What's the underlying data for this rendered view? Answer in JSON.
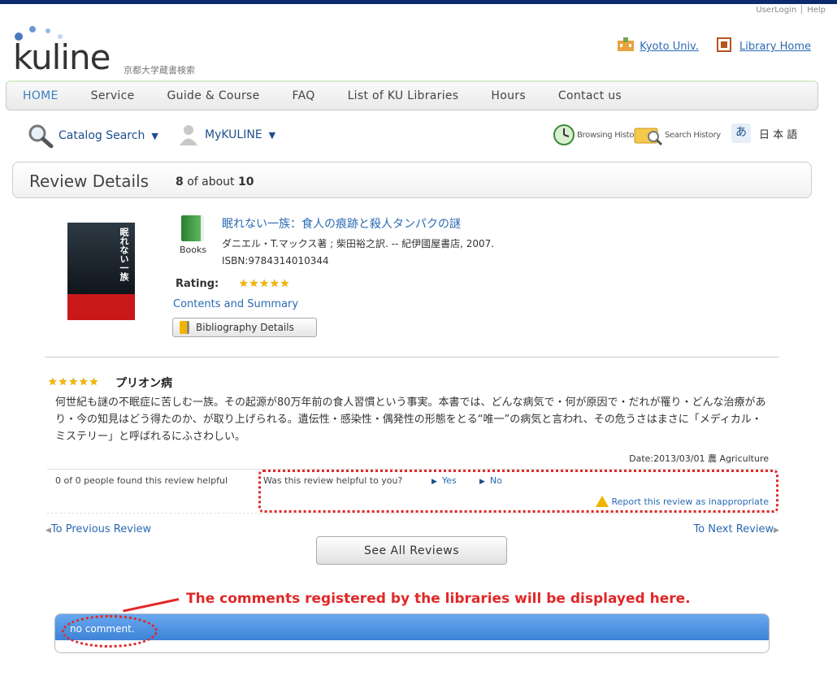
{
  "header": {
    "user_login": "UserLogin",
    "help": "Help",
    "logo_text": "kuline",
    "logo_sub": "京都大学蔵書検索",
    "links": [
      "Kyoto Univ.",
      "Library Home"
    ]
  },
  "nav": {
    "items": [
      "HOME",
      "Service",
      "Guide & Course",
      "FAQ",
      "List of KU Libraries",
      "Hours",
      "Contact us"
    ]
  },
  "toolbar": {
    "catalog_search": "Catalog Search",
    "mykuline": "MyKULINE",
    "browsing_history": "Browsing History",
    "search_history": "Search History",
    "lang_icon": "あ",
    "language": "日 本 語"
  },
  "review_head": {
    "title": "Review Details",
    "current": "8",
    "of_about": "of about",
    "total": "10"
  },
  "book": {
    "type_label": "Books",
    "title": "眠れない一族：食人の痕跡と殺人タンパクの謎",
    "author_line": "ダニエル・T.マックス著 ; 柴田裕之訳. -- 紀伊國屋書店, 2007.",
    "isbn": "ISBN:9784314010344",
    "rating_label": "Rating:",
    "rating": 5,
    "cover_title": "眠れない一族",
    "contents_link": "Contents and Summary",
    "biblio_button": "Bibliography Details"
  },
  "review": {
    "stars": 5,
    "title": "プリオン病",
    "body": "何世紀も謎の不眠症に苦しむ一族。その起源が80万年前の食人習慣という事実。本書では、どんな病気で・何が原因で・だれが罹り・どんな治療があり・今の知見はどう得たのか、が取り上げられる。遺伝性・感染性・偶発性の形態をとる“唯一”の病気と言われ、その危うさはまさに「メディカル・ミステリー」と呼ばれるにふさわしい。",
    "date": "Date:2013/03/01 農 Agriculture",
    "helpful_count": "0 of 0 people found this review helpful",
    "helpful_question": "Was this review helpful to you?",
    "yes": "Yes",
    "no": "No",
    "report": "Report this review as inappropriate"
  },
  "pager": {
    "prev": "To Previous Review",
    "next": "To Next Review",
    "see_all": "See All Reviews"
  },
  "annotation": "The comments registered by the libraries will be displayed here.",
  "comments": {
    "text": "no comment."
  },
  "colors": {
    "link": "#2a6ab3",
    "annotation_red": "#e02828",
    "comment_bar": "#4a90e2",
    "star": "#f2b600"
  }
}
